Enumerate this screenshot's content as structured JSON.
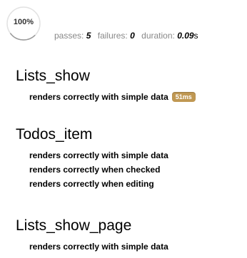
{
  "report": {
    "progress": "100%",
    "progress_value": 1.0,
    "stats": {
      "passes_label": "passes:",
      "passes": "5",
      "failures_label": "failures:",
      "failures": "0",
      "duration_label": "duration:",
      "duration": "0.09",
      "duration_unit": "s"
    },
    "suites": [
      {
        "title": "Lists_show",
        "tests": [
          {
            "title": "renders correctly with simple data",
            "duration": "51ms"
          }
        ]
      },
      {
        "title": "Todos_item",
        "tests": [
          {
            "title": "renders correctly with simple data"
          },
          {
            "title": "renders correctly when checked"
          },
          {
            "title": "renders correctly when editing"
          }
        ]
      },
      {
        "title": "Lists_show_page",
        "tests": [
          {
            "title": "renders correctly with simple data"
          }
        ]
      }
    ]
  },
  "colors": {
    "slow_badge": "#c09853",
    "stat_label": "#888888",
    "progress_ring": "#dddddd"
  }
}
